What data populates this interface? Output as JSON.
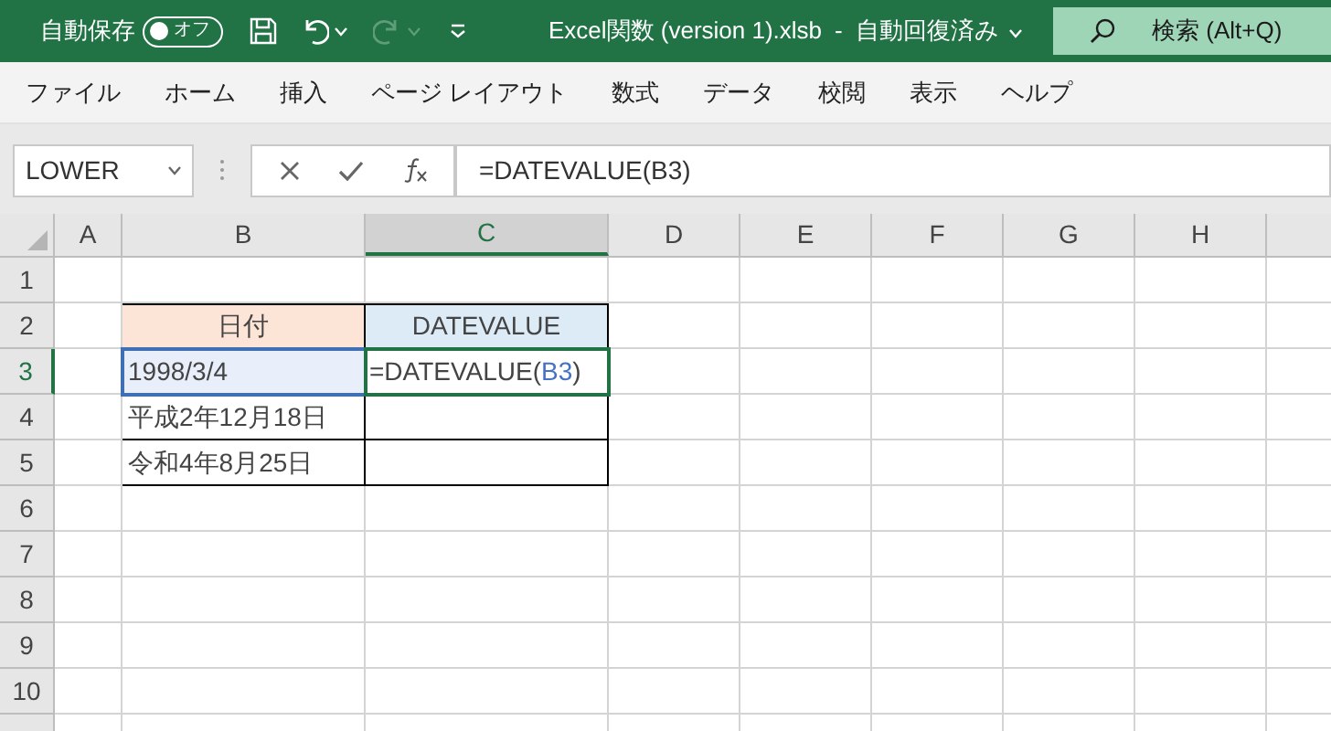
{
  "title_bar": {
    "autosave_label": "自動保存",
    "autosave_toggle": {
      "label": "オフ",
      "on": false
    },
    "undo_enabled": true,
    "redo_enabled": false,
    "file_title": "Excel関数 (version 1).xlsb",
    "separator": "-",
    "save_status": "自動回復済み",
    "search": {
      "placeholder": "検索 (Alt+Q)"
    }
  },
  "menu": [
    {
      "label": "ファイル"
    },
    {
      "label": "ホーム"
    },
    {
      "label": "挿入"
    },
    {
      "label": "ページ レイアウト"
    },
    {
      "label": "数式"
    },
    {
      "label": "データ"
    },
    {
      "label": "校閲"
    },
    {
      "label": "表示"
    },
    {
      "label": "ヘルプ"
    }
  ],
  "formula_bar": {
    "name_box": "LOWER",
    "formula": "=DATEVALUE(B3)"
  },
  "sheet": {
    "columns": [
      {
        "label": "A",
        "selected": false
      },
      {
        "label": "B",
        "selected": false
      },
      {
        "label": "C",
        "selected": true
      },
      {
        "label": "D",
        "selected": false
      },
      {
        "label": "E",
        "selected": false
      },
      {
        "label": "F",
        "selected": false
      },
      {
        "label": "G",
        "selected": false
      },
      {
        "label": "H",
        "selected": false
      }
    ],
    "rows": [
      {
        "label": "1",
        "selected": false,
        "cells": []
      },
      {
        "label": "2",
        "selected": false,
        "cells": [
          "",
          {
            "kind": "header",
            "color": "#fce4d6",
            "text": "日付"
          },
          {
            "kind": "header",
            "color": "#ddebf7",
            "text": "DATEVALUE"
          }
        ]
      },
      {
        "label": "3",
        "selected": true,
        "cells": [
          "",
          {
            "kind": "value",
            "highlighted": true,
            "text": "1998/3/4"
          },
          {
            "kind": "editing",
            "parts": [
              {
                "kind": "plain",
                "text": "=DATEVALUE("
              },
              {
                "kind": "reference",
                "color": "#4472c4",
                "text": "B3"
              },
              {
                "kind": "plain",
                "text": ")"
              }
            ]
          }
        ]
      },
      {
        "label": "4",
        "selected": false,
        "cells": [
          "",
          {
            "kind": "value",
            "highlighted": false,
            "text": "平成2年12月18日"
          },
          {
            "kind": "value",
            "highlighted": false
          }
        ]
      },
      {
        "label": "5",
        "selected": false,
        "cells": [
          "",
          {
            "kind": "value",
            "highlighted": false,
            "text": "令和4年8月25日"
          },
          {
            "kind": "value",
            "highlighted": false
          }
        ]
      },
      {
        "label": "6",
        "selected": false,
        "cells": []
      },
      {
        "label": "7",
        "selected": false,
        "cells": []
      },
      {
        "label": "8",
        "selected": false,
        "cells": []
      },
      {
        "label": "9",
        "selected": false,
        "cells": []
      },
      {
        "label": "10",
        "selected": false,
        "cells": []
      }
    ]
  }
}
